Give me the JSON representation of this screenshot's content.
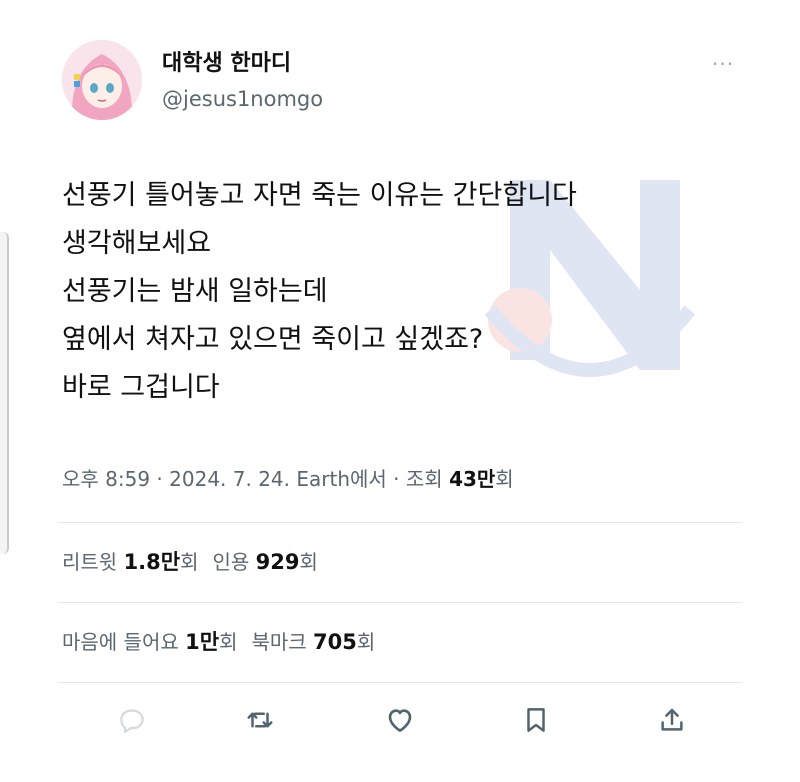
{
  "tweet": {
    "author_name": "대학생 한마디",
    "author_handle": "@jesus1nomgo",
    "more_glyph": "···",
    "lines": [
      "선풍기 틀어놓고 자면 죽는 이유는 간단합니다",
      "생각해보세요",
      "선풍기는 밤새 일하는데",
      "옆에서 쳐자고 있으면 죽이고 싶겠죠?",
      "바로 그겁니다"
    ],
    "meta": {
      "time": "오후 8:59",
      "sep1": " · ",
      "date": "2024. 7. 24.",
      "source": " Earth에서",
      "sep2": " · ",
      "views_prefix": "조회 ",
      "views_value": "43만",
      "views_suffix": "회"
    },
    "stats_row1": {
      "retweets_label": "리트윗 ",
      "retweets_value": "1.8만",
      "retweets_suffix": "회",
      "quotes_label": "인용 ",
      "quotes_value": "929",
      "quotes_suffix": "회"
    },
    "stats_row2": {
      "likes_label": "마음에 들어요 ",
      "likes_value": "1만",
      "likes_suffix": "회",
      "bookmarks_label": "북마크 ",
      "bookmarks_value": "705",
      "bookmarks_suffix": "회"
    }
  },
  "icons": {
    "reply": "reply-icon",
    "retweet": "retweet-icon",
    "like": "heart-icon",
    "bookmark": "bookmark-icon",
    "share": "share-icon"
  },
  "colors": {
    "text": "#111111",
    "secondary": "#5b6670",
    "icon": "#536471",
    "divider": "#e6e8ea"
  }
}
